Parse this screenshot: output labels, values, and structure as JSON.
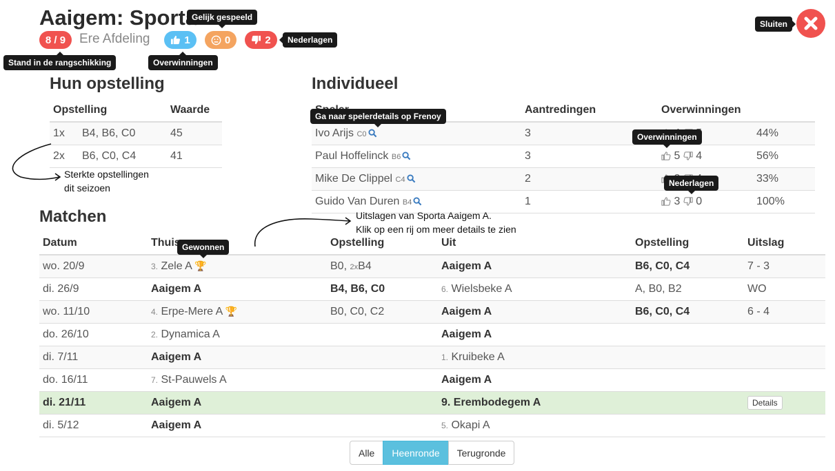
{
  "header": {
    "title": "Aaigem: Sporta A",
    "rank": "8 / 9",
    "division": "Ere Afdeling",
    "wins": "1",
    "draws": "0",
    "losses": "2",
    "close_label": "Sluiten"
  },
  "tooltips": {
    "rank": "Stand in de rangschikking",
    "wins": "Overwinningen",
    "draws": "Gelijk gespeeld",
    "losses": "Nederlagen",
    "player_details": "Ga naar spelerdetails op Frenoy",
    "ind_wins": "Overwinningen",
    "ind_losses": "Nederlagen",
    "won": "Gewonnen"
  },
  "lineups": {
    "heading": "Hun opstelling",
    "col_lineup": "Opstelling",
    "col_value": "Waarde",
    "rows": [
      {
        "count": "1x",
        "players": "B4, B6, C0",
        "value": "45"
      },
      {
        "count": "2x",
        "players": "B6, C0, C4",
        "value": "41"
      }
    ]
  },
  "individual": {
    "heading": "Individueel",
    "col_player": "Speler",
    "col_appearances": "Aantredingen",
    "col_wins": "Overwinningen",
    "rows": [
      {
        "name": "Ivo Arijs",
        "ranking": "C0",
        "appearances": "3",
        "won": "4",
        "lost": "5",
        "pct": "44%"
      },
      {
        "name": "Paul Hoffelinck",
        "ranking": "B6",
        "appearances": "3",
        "won": "5",
        "lost": "4",
        "pct": "56%"
      },
      {
        "name": "Mike De Clippel",
        "ranking": "C4",
        "appearances": "2",
        "won": "2",
        "lost": "4",
        "pct": "33%"
      },
      {
        "name": "Guido Van Duren",
        "ranking": "B4",
        "appearances": "1",
        "won": "3",
        "lost": "0",
        "pct": "100%"
      }
    ]
  },
  "matches": {
    "heading": "Matchen",
    "col_date": "Datum",
    "col_home": "Thuis",
    "col_home_lineup": "Opstelling",
    "col_away": "Uit",
    "col_away_lineup": "Opstelling",
    "col_result": "Uitslag",
    "details_label": "Details",
    "rows": [
      {
        "date": "wo. 20/9",
        "home_rank": "3.",
        "home": "Zele A",
        "home_trophy": "🏆",
        "home_lineup": "B0, ",
        "home_lineup_small": "2x",
        "home_lineup_rest": "B4",
        "away_rank": "",
        "away": "Aaigem A",
        "away_lineup": "B6, C0, C4",
        "result": "7 - 3"
      },
      {
        "date": "di. 26/9",
        "home_rank": "",
        "home": "Aaigem A",
        "home_trophy": "",
        "home_lineup": "B4, B6, C0",
        "home_lineup_small": "",
        "home_lineup_rest": "",
        "away_rank": "6.",
        "away": "Wielsbeke A",
        "away_lineup": "A, B0, B2",
        "result": "WO"
      },
      {
        "date": "wo. 11/10",
        "home_rank": "4.",
        "home": "Erpe-Mere A",
        "home_trophy": "🏆",
        "home_lineup": "B0, C0, C2",
        "home_lineup_small": "",
        "home_lineup_rest": "",
        "away_rank": "",
        "away": "Aaigem A",
        "away_lineup": "B6, C0, C4",
        "result": "6 - 4"
      },
      {
        "date": "do. 26/10",
        "home_rank": "2.",
        "home": "Dynamica A",
        "home_trophy": "",
        "home_lineup": "",
        "home_lineup_small": "",
        "home_lineup_rest": "",
        "away_rank": "",
        "away": "Aaigem A",
        "away_lineup": "",
        "result": ""
      },
      {
        "date": "di. 7/11",
        "home_rank": "",
        "home": "Aaigem A",
        "home_trophy": "",
        "home_lineup": "",
        "home_lineup_small": "",
        "home_lineup_rest": "",
        "away_rank": "1.",
        "away": "Kruibeke A",
        "away_lineup": "",
        "result": ""
      },
      {
        "date": "do. 16/11",
        "home_rank": "7.",
        "home": "St-Pauwels A",
        "home_trophy": "",
        "home_lineup": "",
        "home_lineup_small": "",
        "home_lineup_rest": "",
        "away_rank": "",
        "away": "Aaigem A",
        "away_lineup": "",
        "result": ""
      },
      {
        "date": "di. 21/11",
        "home_rank": "",
        "home": "Aaigem A",
        "home_trophy": "",
        "home_lineup": "",
        "home_lineup_small": "",
        "home_lineup_rest": "",
        "away_rank": "9.",
        "away": "Erembodegem A",
        "away_lineup": "",
        "result": ""
      },
      {
        "date": "di. 5/12",
        "home_rank": "",
        "home": "Aaigem A",
        "home_trophy": "",
        "home_lineup": "",
        "home_lineup_small": "",
        "home_lineup_rest": "",
        "away_rank": "5.",
        "away": "Okapi A",
        "away_lineup": "",
        "result": ""
      }
    ]
  },
  "annotations": {
    "lineups_line1": "Sterkte opstellingen",
    "lineups_line2": "dit seizoen",
    "matches_line1": "Uitslagen van Sporta Aaigem A.",
    "matches_line2": "Klik op een rij om meer details te zien"
  },
  "filters": {
    "all": "Alle",
    "first_round": "Heenronde",
    "second_round": "Terugronde",
    "active": "Heenronde"
  },
  "colors": {
    "red": "#f0524f",
    "blue": "#5bc0f4",
    "orange": "#f4a460",
    "highlight": "#dff0d8",
    "active_filter": "#5bc0de"
  }
}
